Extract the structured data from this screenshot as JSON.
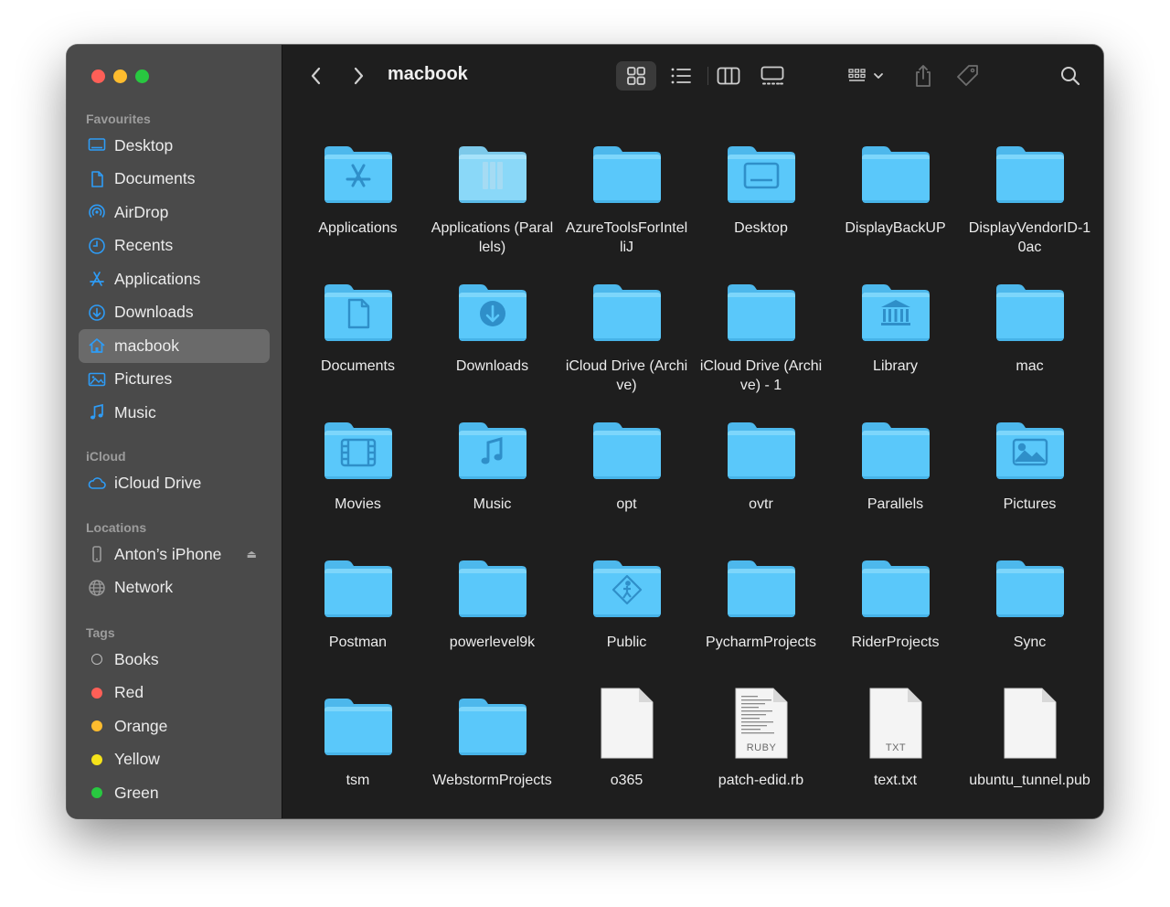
{
  "window": {
    "title": "macbook"
  },
  "sidebar": {
    "favourites_heading": "Favourites",
    "favourites": [
      {
        "label": "Desktop",
        "icon": "desktop-icon"
      },
      {
        "label": "Documents",
        "icon": "document-icon"
      },
      {
        "label": "AirDrop",
        "icon": "airdrop-icon"
      },
      {
        "label": "Recents",
        "icon": "clock-icon"
      },
      {
        "label": "Applications",
        "icon": "applications-icon"
      },
      {
        "label": "Downloads",
        "icon": "download-icon"
      },
      {
        "label": "macbook",
        "icon": "home-icon",
        "selected": true
      },
      {
        "label": "Pictures",
        "icon": "pictures-icon"
      },
      {
        "label": "Music",
        "icon": "music-icon"
      }
    ],
    "icloud_heading": "iCloud",
    "icloud": [
      {
        "label": "iCloud Drive",
        "icon": "cloud-icon"
      }
    ],
    "locations_heading": "Locations",
    "locations": [
      {
        "label": "Anton’s iPhone",
        "icon": "iphone-icon",
        "eject": "⏏"
      },
      {
        "label": "Network",
        "icon": "globe-icon"
      }
    ],
    "tags_heading": "Tags",
    "tags": [
      {
        "label": "Books",
        "color": "",
        "hollow": true
      },
      {
        "label": "Red",
        "color": "#fe5f57"
      },
      {
        "label": "Orange",
        "color": "#febc2e"
      },
      {
        "label": "Yellow",
        "color": "#f5e31a"
      },
      {
        "label": "Green",
        "color": "#28c840"
      }
    ]
  },
  "toolbar": {
    "back": "chevron-left-icon",
    "forward": "chevron-right-icon",
    "title": "macbook",
    "view_modes": [
      "icon-view-icon",
      "list-view-icon",
      "column-view-icon",
      "gallery-view-icon"
    ],
    "active_view": "icon-view-icon"
  },
  "items": [
    {
      "name": "Applications",
      "kind": "folder",
      "glyph": "apps"
    },
    {
      "name": "Applications (Parallels)",
      "kind": "folder-light",
      "glyph": "parallels"
    },
    {
      "name": "AzureToolsForIntelliJ",
      "kind": "folder",
      "glyph": ""
    },
    {
      "name": "Desktop",
      "kind": "folder",
      "glyph": "desktop"
    },
    {
      "name": "DisplayBackUP",
      "kind": "folder",
      "glyph": ""
    },
    {
      "name": "DisplayVendorID-10ac",
      "kind": "folder",
      "glyph": ""
    },
    {
      "name": "Documents",
      "kind": "folder",
      "glyph": "document"
    },
    {
      "name": "Downloads",
      "kind": "folder",
      "glyph": "download"
    },
    {
      "name": "iCloud Drive (Archive)",
      "kind": "folder",
      "glyph": ""
    },
    {
      "name": "iCloud Drive (Archive) - 1",
      "kind": "folder",
      "glyph": ""
    },
    {
      "name": "Library",
      "kind": "folder",
      "glyph": "library"
    },
    {
      "name": "mac",
      "kind": "folder",
      "glyph": ""
    },
    {
      "name": "Movies",
      "kind": "folder",
      "glyph": "movies"
    },
    {
      "name": "Music",
      "kind": "folder",
      "glyph": "music"
    },
    {
      "name": "opt",
      "kind": "folder",
      "glyph": ""
    },
    {
      "name": "ovtr",
      "kind": "folder",
      "glyph": ""
    },
    {
      "name": "Parallels",
      "kind": "folder",
      "glyph": ""
    },
    {
      "name": "Pictures",
      "kind": "folder",
      "glyph": "pictures"
    },
    {
      "name": "Postman",
      "kind": "folder",
      "glyph": ""
    },
    {
      "name": "powerlevel9k",
      "kind": "folder",
      "glyph": ""
    },
    {
      "name": "Public",
      "kind": "folder",
      "glyph": "public"
    },
    {
      "name": "PycharmProjects",
      "kind": "folder",
      "glyph": ""
    },
    {
      "name": "RiderProjects",
      "kind": "folder",
      "glyph": ""
    },
    {
      "name": "Sync",
      "kind": "folder",
      "glyph": ""
    },
    {
      "name": "tsm",
      "kind": "folder",
      "glyph": ""
    },
    {
      "name": "WebstormProjects",
      "kind": "folder",
      "glyph": ""
    },
    {
      "name": "o365",
      "kind": "file",
      "badge": ""
    },
    {
      "name": "patch-edid.rb",
      "kind": "file",
      "badge": "RUBY",
      "lines": true
    },
    {
      "name": "text.txt",
      "kind": "file",
      "badge": "TXT"
    },
    {
      "name": "ubuntu_tunnel.pub",
      "kind": "file",
      "badge": ""
    }
  ],
  "colors": {
    "folder": "#5ac8fa",
    "folder_tab": "#7dd6fb",
    "folder_glyph": "#2f8fc9",
    "sidebar_icon": "#2e9cf6"
  }
}
